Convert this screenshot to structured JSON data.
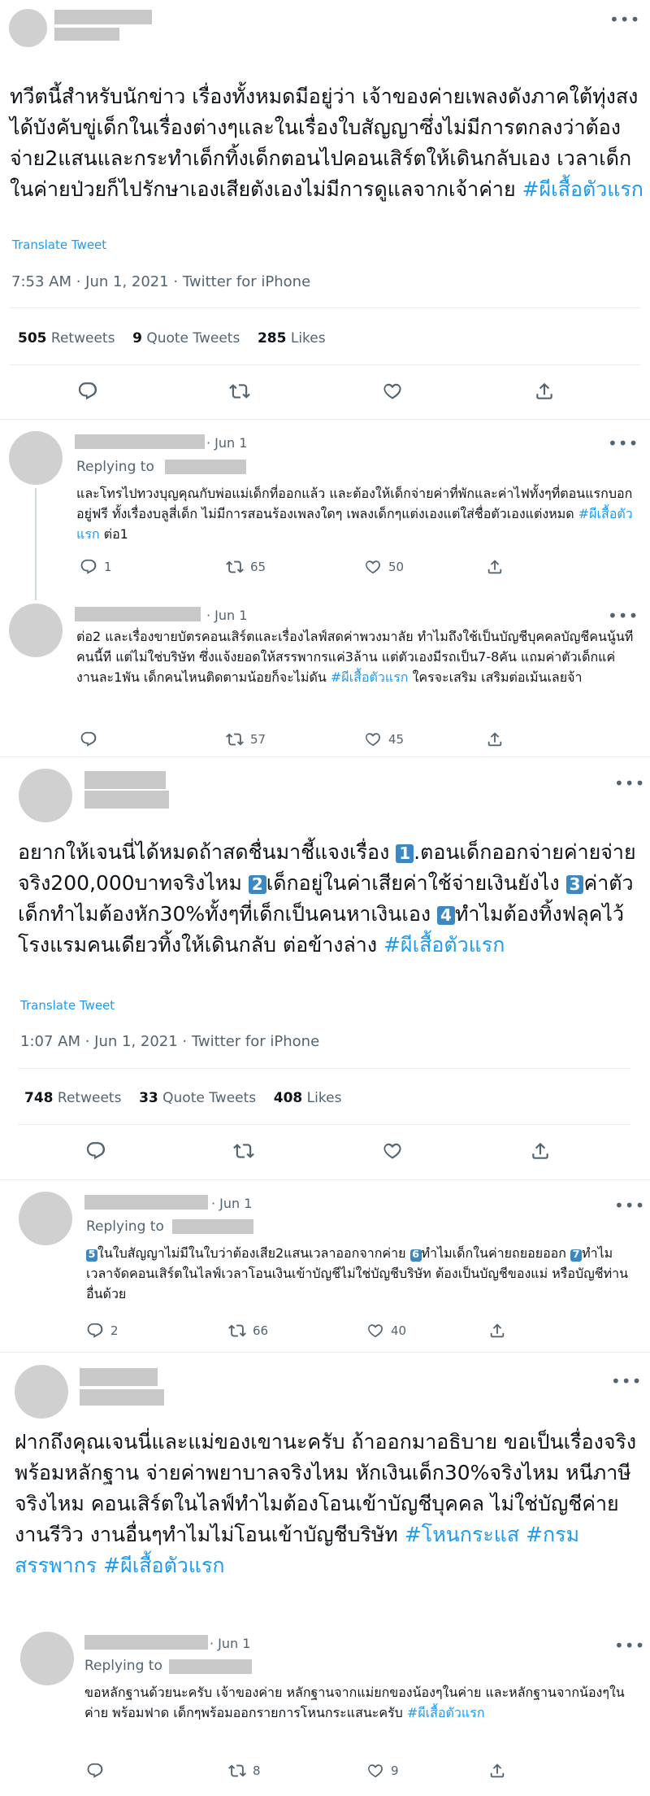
{
  "tweet1": {
    "text": "ทวีตนี้สำหรับนักข่าว เรื่องทั้งหมดมีอยู่ว่า เจ้าของค่ายเพลงดังภาคใต้ทุ่งสง ได้บังคับขู่เด็กในเรื่องต่างๆและในเรื่องใบสัญญาซึ่งไม่มีการตกลงว่าต้องจ่าย2แสนและกระทำเด็กทิ้งเด็กตอนไปคอนเสิร์ตให้เดินกลับเอง เวลาเด็กในค่ายป่วยก็ไปรักษาเองเสียตังเองไม่มีการดูแลจากเจ้าค่าย ",
    "hashtag": "#ผีเสื้อตัวแรก",
    "translate": "Translate Tweet",
    "meta": "7:53 AM · Jun 1, 2021 · Twitter for iPhone",
    "retweets_count": "505",
    "retweets_label": "Retweets",
    "quotes_count": "9",
    "quotes_label": "Quote Tweets",
    "likes_count": "285",
    "likes_label": "Likes"
  },
  "reply1": {
    "date": "· Jun 1",
    "replying": "Replying to",
    "text": "และโทรไปทวงบุญคุณกับพ่อแม่เด็กที่ออกแล้ว และต้องให้เด็กจ่ายค่าที่พักและค่าไฟทั้งๆที่ตอนแรกบอกอยู่ฟรี ทั้งเรื่องบลูสี่เด็ก ไม่มีการสอนร้องเพลงใดๆ เพลงเด็กๆแต่งเองแต่ใส่ชื่อตัวเองแต่งหมด ",
    "hashtag": "#ผีเสื้อตัวแรก",
    "tail": "  ต่อ1",
    "replies": "1",
    "retweets": "65",
    "likes": "50"
  },
  "reply2": {
    "date": "· Jun 1",
    "text": "ต่อ2 และเรื่องขายบัตรคอนเสิร์ตและเรื่องไลฟ์สดค่าพวงมาลัย ทำไมถึงใช้เป็นบัญชีบุคคลบัญชีคนนู้นทีคนนี้ที แต่ไม่ใช่บริษัท ซึ่งแจ้งยอดให้สรรพากรแค่3ล้าน แต่ตัวเองมีรถเป็น7-8คัน แถมค่าตัวเด็กแค่งานละ1พัน เด็กคนไหนติดตามน้อยก็จะไม่ดัน ",
    "hashtag": "#ผีเสื้อตัวแรก",
    "tail": " ใครจะเสริม เสริมต่อเม้นเลยจ้า",
    "replies": "",
    "retweets": "57",
    "likes": "45"
  },
  "tweet2": {
    "p1": "อยากให้เจนนี่ได้หมดถ้าสดชื่นมาชี้แจงเรื่อง ",
    "b1": "1",
    "p2": ".ตอนเด็กออกจ่ายค่ายจ่ายจริง200,000บาทจริงไหม ",
    "b2": "2",
    "p3": "เด็กอยู่ในค่าเสียค่าใช้จ่ายเงินยังไง ",
    "b3": "3",
    "p4": "ค่าตัวเด็กทำไมต้องหัก30%ทั้งๆที่เด็กเป็นคนหาเงินเอง  ",
    "b4": "4",
    "p5": "ทำไมต้องทิ้งฟลุคไว้โรงแรมคนเดียวทิ้งให้เดินกลับ ต่อข้างล่าง ",
    "hashtag": "#ผีเสื้อตัวแรก",
    "translate": "Translate Tweet",
    "meta": "1:07 AM · Jun 1, 2021 · Twitter for iPhone",
    "retweets_count": "748",
    "retweets_label": "Retweets",
    "quotes_count": "33",
    "quotes_label": "Quote Tweets",
    "likes_count": "408",
    "likes_label": "Likes"
  },
  "reply3": {
    "date": "· Jun 1",
    "replying": "Replying to",
    "b5": "5",
    "p1": "ในใบสัญญาไม่มีในใบว่าต้องเสีย2แสนเวลาออกจากค่าย ",
    "b6": "6",
    "p2": "ทำไมเด็กในค่ายถยอยออก ",
    "b7": "7",
    "p3": "ทำไมเวลาจัดคอนเสิร์ตในไลฟ์เวลาโอนเงินเข้าบัญชีไม่ใช่บัญชีบริษัท ต้องเป็นบัญชีของแม่ หรือบัญชีท่านอื่นด้วย",
    "replies": "2",
    "retweets": "66",
    "likes": "40"
  },
  "tweet3": {
    "text": "ฝากถึงคุณเจนนี่และแม่ของเขานะครับ ถ้าออกมาอธิบาย ขอเป็นเรื่องจริง พร้อมหลักฐาน จ่ายค่าพยาบาลจริงไหม หักเงินเด็ก30%จริงไหม หนีภาษีจริงไหม คอนเสิร์ตในไลฟ์ทำไมต้องโอนเข้าบัญชีบุคคล ไม่ใช่บัญชีค่าย งานรีวิว งานอื่นๆทำไมไม่โอนเข้าบัญชีบริษัท ",
    "h1": "#โหนกระแส",
    "h2": "#กรมสรรพากร",
    "h3": "#ผีเสื้อตัวแรก"
  },
  "reply4": {
    "date": "· Jun 1",
    "replying": "Replying to",
    "text": "ขอหลักฐานด้วยนะครับ เจ้าของค่าย หลักฐานจากแม่ยกของน้องๆในค่าย และหลักฐานจากน้องๆในค่าย พร้อมฟาด เด็กๆพร้อมออกรายการโหนกระแสนะครับ ",
    "hashtag": "#ผีเสื้อตัวแรก",
    "replies": "",
    "retweets": "8",
    "likes": "9"
  },
  "icons": [
    "more-icon",
    "reply-icon",
    "retweet-icon",
    "like-icon",
    "share-icon"
  ],
  "colors": {
    "link": "#1d9bf0",
    "muted": "#536471",
    "badge": "#3b88c3",
    "divider": "#e6ecf0"
  }
}
